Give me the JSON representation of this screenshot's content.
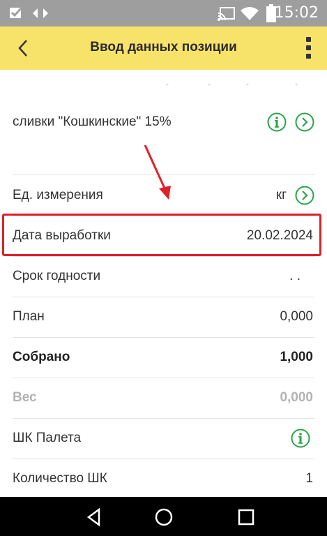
{
  "status_bar": {
    "time": "15:02",
    "icons": [
      "checkbox-icon",
      "diamond-icon",
      "cast-icon",
      "wifi-icon",
      "battery-icon"
    ]
  },
  "app_bar": {
    "title": "Ввод данных позиции",
    "back_icon": "back-chevron-icon",
    "menu_icon": "more-vert-icon",
    "background": "#f8e36a"
  },
  "product": {
    "name": "сливки \"Кошкинские\" 15%",
    "icons": [
      "info-icon",
      "chevron-right-circle-icon"
    ]
  },
  "fields": [
    {
      "label": "Ед. измерения",
      "value": "кг",
      "icon": "chevron-right-circle-icon"
    },
    {
      "label": "Дата выработки",
      "value": "20.02.2024",
      "highlighted": true
    },
    {
      "label": "Срок годности",
      "value": ". ."
    },
    {
      "label": "План",
      "value": "0,000"
    },
    {
      "label": "Собрано",
      "value": "1,000",
      "style": "bold"
    },
    {
      "label": "Вес",
      "value": "0,000",
      "style": "muted"
    },
    {
      "label": "ШК Палета",
      "value": "",
      "icon": "info-icon"
    },
    {
      "label": "Количество ШК",
      "value": "1"
    }
  ],
  "nav_bar": {
    "buttons": [
      "back-triangle-icon",
      "home-circle-icon",
      "recents-square-icon"
    ]
  },
  "annotation": {
    "color": "#e0202a"
  }
}
